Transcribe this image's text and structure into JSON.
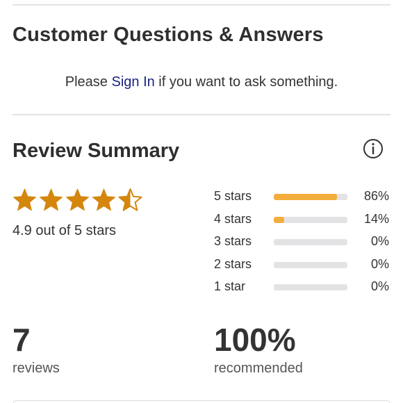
{
  "questions": {
    "title": "Customer Questions & Answers",
    "prompt_before": "Please ",
    "sign_in_label": "Sign In",
    "prompt_after": " if you want to ask something."
  },
  "review_summary": {
    "title": "Review Summary",
    "info_icon": "info-icon",
    "average_rating": 4.9,
    "max_rating": 5,
    "stars_display": [
      "full",
      "full",
      "full",
      "full",
      "half"
    ],
    "star_color": "#d4860d",
    "rating_text": "4.9 out of 5 stars",
    "bar_fill_color": "#f2ad3d",
    "bar_track_color": "#e3e3e6",
    "distribution": [
      {
        "label": "5 stars",
        "percent_text": "86%",
        "fraction": 0.86
      },
      {
        "label": "4 stars",
        "percent_text": "14%",
        "fraction": 0.14
      },
      {
        "label": "3 stars",
        "percent_text": "0%",
        "fraction": 0
      },
      {
        "label": "2 stars",
        "percent_text": "0%",
        "fraction": 0
      },
      {
        "label": "1 star",
        "percent_text": "0%",
        "fraction": 0
      }
    ],
    "reviews_count": "7",
    "reviews_label": "reviews",
    "recommended_percent": "100%",
    "recommended_label": "recommended"
  }
}
